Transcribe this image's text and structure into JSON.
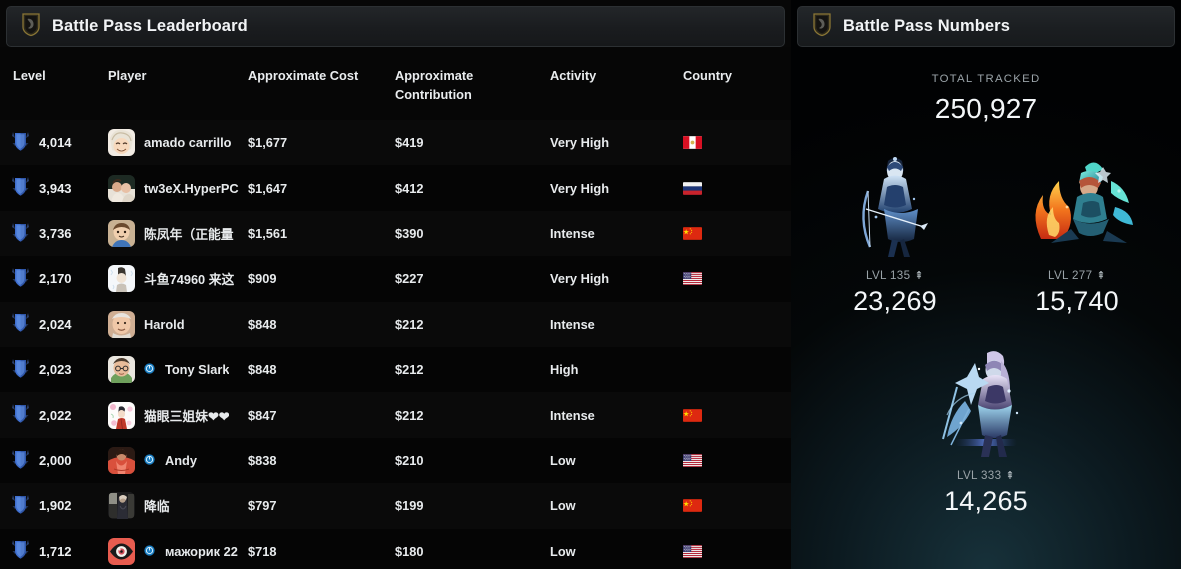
{
  "leaderboard": {
    "title": "Battle Pass Leaderboard",
    "icon": "shield-icon",
    "columns": {
      "level": "Level",
      "player": "Player",
      "cost": "Approximate Cost",
      "contribution_line1": "Approximate",
      "contribution_line2": "Contribution",
      "activity": "Activity",
      "country": "Country"
    },
    "rows": [
      {
        "level": "4,014",
        "player": "amado carrillo",
        "verified": false,
        "cost": "$1,677",
        "contribution": "$419",
        "activity": "Very High",
        "country": "PE",
        "avatar": "anime-blonde"
      },
      {
        "level": "3,943",
        "player": "tw3eX.HyperPC",
        "verified": false,
        "cost": "$1,647",
        "contribution": "$412",
        "activity": "Very High",
        "country": "RU",
        "avatar": "couple-photo"
      },
      {
        "level": "3,736",
        "player": "陈凤年（正能量",
        "verified": false,
        "cost": "$1,561",
        "contribution": "$390",
        "activity": "Intense",
        "country": "CN",
        "avatar": "cartoon-boy"
      },
      {
        "level": "2,170",
        "player": "斗鱼74960 来这",
        "verified": false,
        "cost": "$909",
        "contribution": "$227",
        "activity": "Very High",
        "country": "US",
        "avatar": "white-sketch"
      },
      {
        "level": "2,024",
        "player": "Harold",
        "verified": false,
        "cost": "$848",
        "contribution": "$212",
        "activity": "Intense",
        "country": "",
        "avatar": "old-man"
      },
      {
        "level": "2,023",
        "player": "Tony Slark",
        "verified": true,
        "cost": "$848",
        "contribution": "$212",
        "activity": "High",
        "country": "",
        "avatar": "glasses-person"
      },
      {
        "level": "2,022",
        "player": "猫眼三姐妹❤❤",
        "verified": false,
        "cost": "$847",
        "contribution": "$212",
        "activity": "Intense",
        "country": "CN",
        "avatar": "floral-anime"
      },
      {
        "level": "2,000",
        "player": "Andy",
        "verified": true,
        "cost": "$838",
        "contribution": "$210",
        "activity": "Low",
        "country": "US",
        "avatar": "red-robe"
      },
      {
        "level": "1,902",
        "player": "降临",
        "verified": false,
        "cost": "$797",
        "contribution": "$199",
        "activity": "Low",
        "country": "CN",
        "avatar": "dark-photo"
      },
      {
        "level": "1,712",
        "player": "мажорик 22",
        "verified": true,
        "cost": "$718",
        "contribution": "$180",
        "activity": "Low",
        "country": "US",
        "avatar": "red-eye"
      }
    ]
  },
  "numbers": {
    "title": "Battle Pass Numbers",
    "icon": "shield-icon",
    "total_label": "TOTAL TRACKED",
    "total_value": "250,927",
    "heroes": [
      {
        "level_label": "LVL 135",
        "arrow": "⇞",
        "value": "23,269",
        "art": "drow-ranger"
      },
      {
        "level_label": "LVL 277",
        "arrow": "⇞",
        "value": "15,740",
        "art": "puck-fire"
      },
      {
        "level_label": "LVL 333",
        "arrow": "⇞",
        "value": "14,265",
        "art": "crystal-maiden"
      }
    ]
  },
  "colors": {
    "accent_blue": "#4a78d8",
    "verified_blue": "#1b7fc4",
    "panel_bg": "#070707",
    "row_bg": "#0a0a0a",
    "row_alt_bg": "#050505",
    "text": "#e8ebed",
    "muted": "#9aa3a8"
  }
}
